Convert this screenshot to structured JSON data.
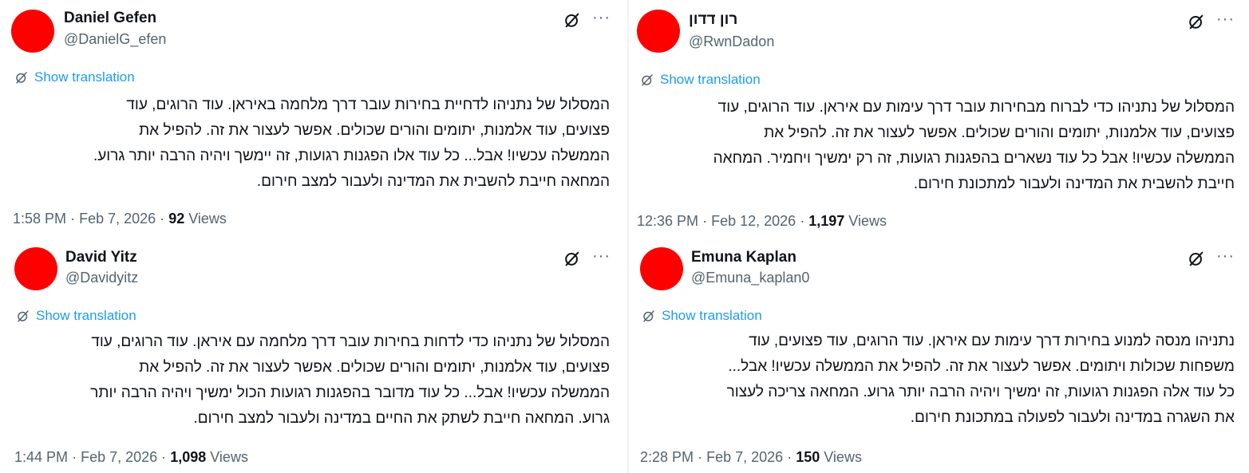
{
  "ui": {
    "show_translation": "Show translation",
    "views_label": "Views",
    "more_glyph": "···",
    "separator": "·",
    "colors": {
      "link": "#1d9bf0",
      "secondary": "#536471",
      "text": "#0f1419",
      "avatar": "#ff0000"
    },
    "icons": {
      "grok": "grok-icon",
      "more": "more-icon",
      "translate": "translate-icon"
    }
  },
  "tweets": [
    {
      "name": "Daniel Gefen",
      "handle": "@DanielG_efen",
      "lines": [
        "המסלול של נתניהו לדחיית בחירות עובר דרך מלחמה באיראן. עוד הרוגים, עוד",
        "פצועים, עוד אלמנות, יתומים והורים שכולים. אפשר לעצור את זה. להפיל את",
        "הממשלה עכשיו! אבל... כל עוד אלו הפגנות רגועות, זה יימשך ויהיה הרבה יותר גרוע.",
        "המחאה חייבת להשבית את המדינה ולעבור למצב חירום."
      ],
      "time": "1:58 PM",
      "date": "Feb 7, 2026",
      "views": "92"
    },
    {
      "name": "רון דדון",
      "handle": "@RwnDadon",
      "lines": [
        "המסלול של נתניהו כדי לברוח מבחירות עובר דרך עימות עם איראן. עוד הרוגים, עוד",
        "פצועים, עוד אלמנות, יתומים והורים שכולים. אפשר לעצור את זה. להפיל את",
        "הממשלה עכשיו! אבל כל עוד נשארים בהפגנות רגועות, זה רק ימשיך ויחמיר. המחאה",
        "חייבת להשבית את המדינה ולעבור למתכונת חירום."
      ],
      "time": "12:36 PM",
      "date": "Feb 12, 2026",
      "views": "1,197"
    },
    {
      "name": "David Yitz",
      "handle": "@Davidyitz",
      "lines": [
        "המסלול של נתניהו כדי לדחות בחירות עובר דרך מלחמה עם איראן. עוד הרוגים, עוד",
        "פצועים, עוד אלמנות, יתומים והורים שכולים. אפשר לעצור את זה. להפיל את",
        "הממשלה עכשיו! אבל... כל עוד מדובר בהפגנות רגועות הכול ימשיך ויהיה הרבה יותר",
        "גרוע. המחאה חייבת לשתק את החיים במדינה ולעבור למצב חירום."
      ],
      "time": "1:44 PM",
      "date": "Feb 7, 2026",
      "views": "1,098"
    },
    {
      "name": "Emuna Kaplan",
      "handle": "@Emuna_kaplan0",
      "lines": [
        "נתניהו מנסה למנוע בחירות דרך עימות עם איראן. עוד הרוגים, עוד פצועים, עוד",
        "משפחות שכולות ויתומים. אפשר לעצור את זה. להפיל את הממשלה עכשיו! אבל...",
        "כל עוד אלה הפגנות רגועות, זה ימשיך ויהיה הרבה יותר גרוע. המחאה צריכה לעצור",
        "את השגרה במדינה ולעבור לפעולה במתכונת חירום."
      ],
      "time": "2:28 PM",
      "date": "Feb 7, 2026",
      "views": "150"
    }
  ]
}
